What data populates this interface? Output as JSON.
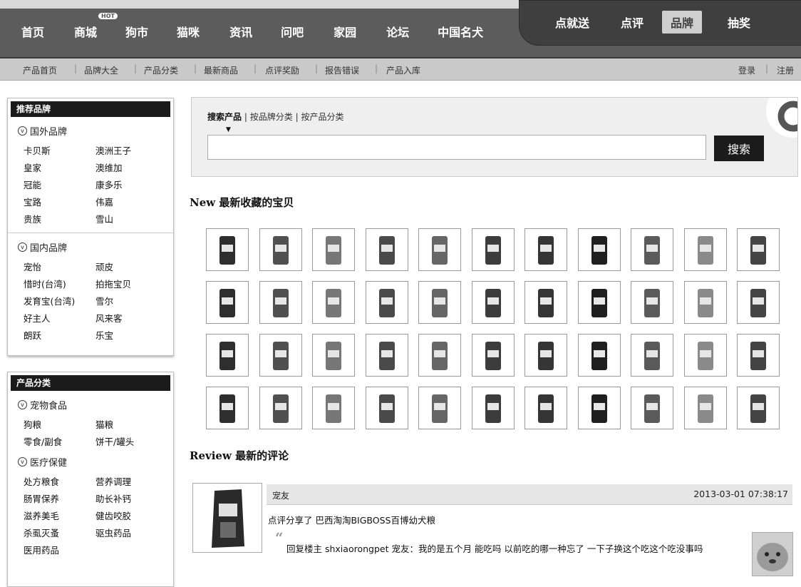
{
  "top_nav": {
    "items": [
      "首页",
      "商城",
      "狗市",
      "猫咪",
      "资讯",
      "问吧",
      "家园",
      "论坛",
      "中国名犬"
    ],
    "hot_badge": "HOT",
    "right_items": [
      "点就送",
      "点评",
      "品牌",
      "抽奖"
    ],
    "active_right": "品牌"
  },
  "sub_nav": {
    "items": [
      "产品首页",
      "品牌大全",
      "产品分类",
      "最新商品",
      "点评奖励",
      "报告错误",
      "产品入库"
    ],
    "login": "登录",
    "register": "注册"
  },
  "sidebar": {
    "brands": {
      "title": "推荐品牌",
      "groups": [
        {
          "title": "国外品牌",
          "links": [
            "卡贝斯",
            "澳洲王子",
            "皇家",
            "澳维加",
            "冠能",
            "康多乐",
            "宝路",
            "伟嘉",
            "贵族",
            "雪山"
          ]
        },
        {
          "title": "国内品牌",
          "links": [
            "宠怡",
            "顽皮",
            "惜时(台湾)",
            "拍拖宝贝",
            "发育宝(台湾)",
            "雪尔",
            "好主人",
            "风来客",
            "朗跃",
            "乐宝"
          ]
        }
      ]
    },
    "categories": {
      "title": "产品分类",
      "groups": [
        {
          "title": "宠物食品",
          "links": [
            "狗粮",
            "猫粮",
            "零食/副食",
            "饼干/罐头"
          ]
        },
        {
          "title": "医疗保健",
          "links": [
            "处方粮食",
            "营养调理",
            "肠胃保养",
            "助长补钙",
            "滋养美毛",
            "健齿咬胶",
            "杀虱灭蚤",
            "驱虫药品",
            "医用药品"
          ]
        }
      ]
    }
  },
  "search": {
    "tab_active": "搜索产品",
    "tab_2": "按品牌分类",
    "tab_3": "按产品分类",
    "separator": "|",
    "value": "",
    "button": "搜索"
  },
  "new_section": {
    "title": "New 最新收藏的宝贝"
  },
  "review_section": {
    "title": "Review 最新的评论",
    "user": "宠友",
    "time": "2013-03-01 07:38:17",
    "line": "点评分享了 巴西淘淘BIGBOSS百博幼犬粮",
    "quote": "回复楼主 shxiaorongpet 宠友：我的是五个月 能吃吗 以前吃的哪一种忘了 一下子换这个吃这个吃没事吗"
  },
  "colors": {
    "dark": "#1b1b1b",
    "nav_bg": "#5c5c5c",
    "subnav_bg": "#c9c9c9"
  }
}
